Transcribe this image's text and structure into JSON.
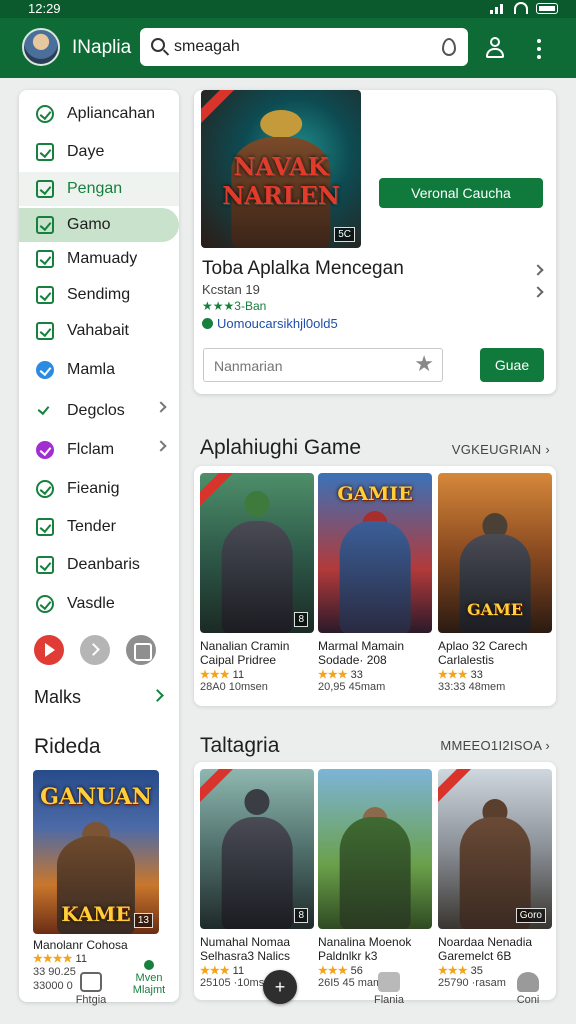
{
  "status": {
    "time": "12:29"
  },
  "appbar": {
    "title": "INaplia",
    "search_value": "smeagah"
  },
  "sidebar": {
    "items": [
      {
        "label": "Apliancahan",
        "icon": "search-icon"
      },
      {
        "label": "Daye",
        "icon": "check-box-icon"
      },
      {
        "label": "Pengan",
        "icon": "chart-icon"
      },
      {
        "label": "Gamo",
        "icon": "check-box-icon"
      },
      {
        "label": "Mamuady",
        "icon": "clipboard-icon"
      },
      {
        "label": "Sendimg",
        "icon": "check-box-icon"
      },
      {
        "label": "Vahabait",
        "icon": "clipboard-icon"
      },
      {
        "label": "Mamla",
        "icon": "check-circle-icon"
      },
      {
        "label": "Degclos",
        "icon": "trend-icon"
      },
      {
        "label": "Flclam",
        "icon": "check-circle-icon"
      },
      {
        "label": "Fieanig",
        "icon": "refresh-icon"
      },
      {
        "label": "Tender",
        "icon": "mail-icon"
      },
      {
        "label": "Deanbaris",
        "icon": "check-box-icon"
      },
      {
        "label": "Vasdle",
        "icon": "check-circle-icon"
      }
    ],
    "more_label": "Malks",
    "section_title": "Rideda",
    "card": {
      "cover_top": "GANUAN",
      "cover_bottom": "KAME",
      "badge": "13",
      "title": "Manolanr Cohosa",
      "stars": "★★★★",
      "rating": "11",
      "meta1": "33 90.25",
      "meta2": "33000 0"
    }
  },
  "featured": {
    "cover_title": "NAVAK NARLEN",
    "badge": "5C",
    "primary_button": "Veronal Caucha",
    "title": "Toba Aplalka Mencegan",
    "subtitle": "Kcstan 19",
    "rating": "★★★3-Ban",
    "verified": "Uomoucarsikhjl0old5",
    "input_placeholder": "Nanmarian",
    "go_button": "Guae"
  },
  "section1": {
    "title": "Aplahiughi Game",
    "link": "VGKEUGRIAN",
    "cards": [
      {
        "title": "Nanalian Cramin Caipal Pridree",
        "stars": "★★★",
        "rating": "11",
        "meta": "28A0 10msen",
        "badge": "8",
        "cover": ""
      },
      {
        "title": "Marmal Mamain Sodade· 208",
        "stars": "★★★",
        "rating": "33",
        "meta": "20,95 45mam",
        "badge": "",
        "cover": "GAMIE"
      },
      {
        "title": "Aplao 32 Carech Carlalestis",
        "stars": "★★★",
        "rating": "33",
        "meta": "33:33 48mem",
        "badge": "",
        "cover": "GAME"
      }
    ]
  },
  "section2": {
    "title": "Taltagria",
    "link": "MMEEO1I2ISOA",
    "cards": [
      {
        "title": "Numahal Nomaa Selhasra3 Nalics",
        "stars": "★★★",
        "rating": "11",
        "meta": "25105 ·10msem",
        "badge": "8",
        "cover": ""
      },
      {
        "title": "Nanalina Moenok Paldnlkr k3",
        "stars": "★★★",
        "rating": "56",
        "meta": "26I5 45 mam",
        "badge": "",
        "cover": ""
      },
      {
        "title": "Noardaa Nenadia Garemelct 6B",
        "stars": "★★★",
        "rating": "35",
        "meta": "25790 ·rasam",
        "badge": "Goro",
        "cover": ""
      }
    ]
  },
  "bottom_nav": {
    "items": [
      {
        "label": "Fhtgia"
      },
      {
        "label": "Mven Mlajmt"
      },
      {
        "label": "Flania"
      },
      {
        "label": "Coni"
      }
    ],
    "fab": "+"
  },
  "colors": {
    "brand": "#0f6b36",
    "accent": "#0f7a3b",
    "active_bg": "#c8e2cc"
  }
}
